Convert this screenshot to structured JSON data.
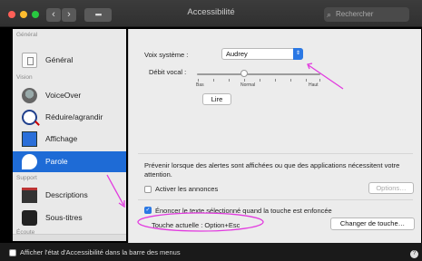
{
  "window": {
    "title": "Accessibilité",
    "search_placeholder": "Rechercher"
  },
  "toolbar": {
    "back": "‹",
    "forward": "›",
    "grid": "▪▪▪"
  },
  "sidebar": {
    "sections": {
      "general": "Général",
      "vision": "Vision",
      "support": "Support",
      "ecoute": "Écoute"
    },
    "items": [
      {
        "label": "Général",
        "icon": "general-icon"
      },
      {
        "label": "VoiceOver",
        "icon": "voiceover-icon"
      },
      {
        "label": "Réduire/agrandir",
        "icon": "zoom-icon"
      },
      {
        "label": "Affichage",
        "icon": "display-icon"
      },
      {
        "label": "Parole",
        "icon": "speech-icon",
        "selected": true
      },
      {
        "label": "Descriptions",
        "icon": "descriptions-icon"
      },
      {
        "label": "Sous-titres",
        "icon": "subtitles-icon"
      }
    ]
  },
  "speech": {
    "voice_label": "Voix système :",
    "voice_value": "Audrey",
    "rate_label": "Débit vocal :",
    "rate_low": "Bas",
    "rate_mid": "Normal",
    "rate_high": "Haut",
    "rate_fraction": 0.38,
    "play_button": "Lire",
    "alerts_text": "Prévenir lorsque des alertes sont affichées ou que des applications nécessitent votre attention.",
    "announce_label": "Activer les annonces",
    "announce_checked": false,
    "options_button": "Options…",
    "speak_selection_label": "Énoncer le texte sélectionné quand la touche est enfoncée",
    "speak_selection_checked": true,
    "current_key_label": "Touche actuelle : Option+Esc",
    "change_key_button": "Changer de touche…"
  },
  "footer": {
    "menu_bar_label": "Afficher l'état d'Accessibilité dans la barre des menus",
    "help": "?"
  },
  "colors": {
    "accent": "#1e6bd6",
    "annotation": "#e23adf"
  }
}
